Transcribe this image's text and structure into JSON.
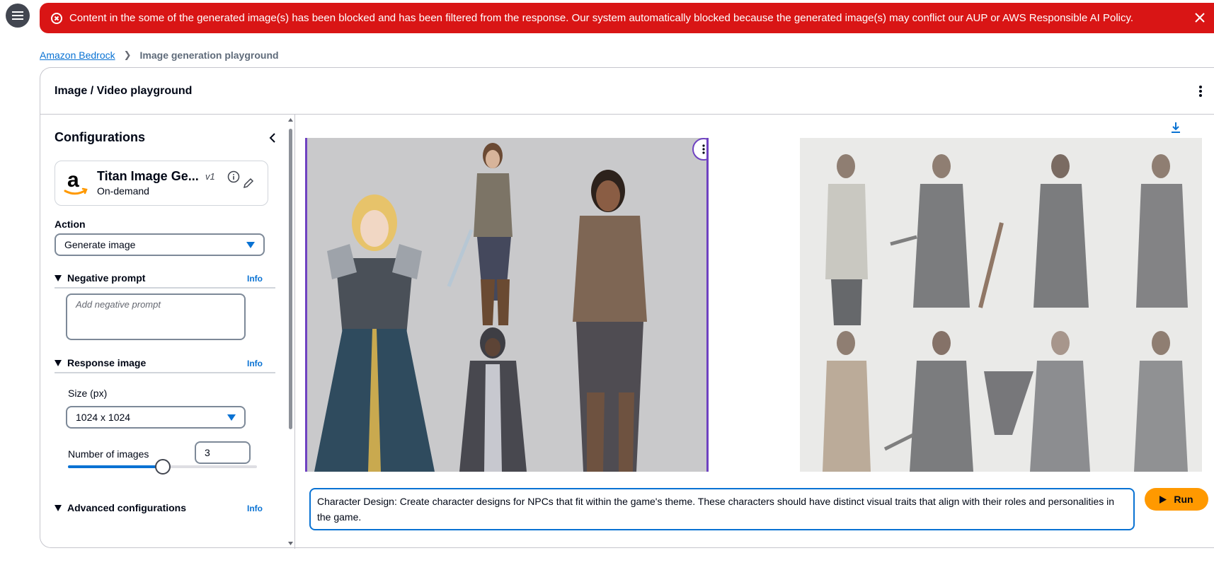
{
  "flash": {
    "message": "Content in the some of the generated image(s) has been blocked and has been filtered from the response. Our system automatically blocked because the generated image(s) may conflict our AUP or AWS Responsible AI Policy.",
    "color": "#d91515",
    "icons": [
      "error-icon",
      "close-icon"
    ]
  },
  "breadcrumb": {
    "root": "Amazon Bedrock",
    "current": "Image generation playground"
  },
  "header": {
    "title": "Image / Video playground"
  },
  "config": {
    "title": "Configurations",
    "model": {
      "name": "Titan Image Ge...",
      "version": "v1",
      "mode": "On-demand"
    },
    "action": {
      "label": "Action",
      "value": "Generate image"
    },
    "negative_prompt": {
      "title": "Negative prompt",
      "info": "Info",
      "placeholder": "Add negative prompt"
    },
    "response_image": {
      "title": "Response image",
      "info": "Info",
      "size_label": "Size (px)",
      "size_value": "1024 x 1024",
      "num_images_label": "Number of images",
      "num_images_value": "3",
      "slider_fraction": 0.5
    },
    "advanced": {
      "title": "Advanced configurations",
      "info": "Info"
    }
  },
  "output": {
    "images": [
      "generated-image-1",
      "generated-image-2"
    ]
  },
  "prompt": {
    "text": "Character Design: Create character designs for NPCs that fit within the game's theme. These characters should have distinct visual traits that align with their roles and personalities in the game."
  },
  "run_button": {
    "label": "Run",
    "color": "#ff9900"
  },
  "accent": "#0972d3"
}
